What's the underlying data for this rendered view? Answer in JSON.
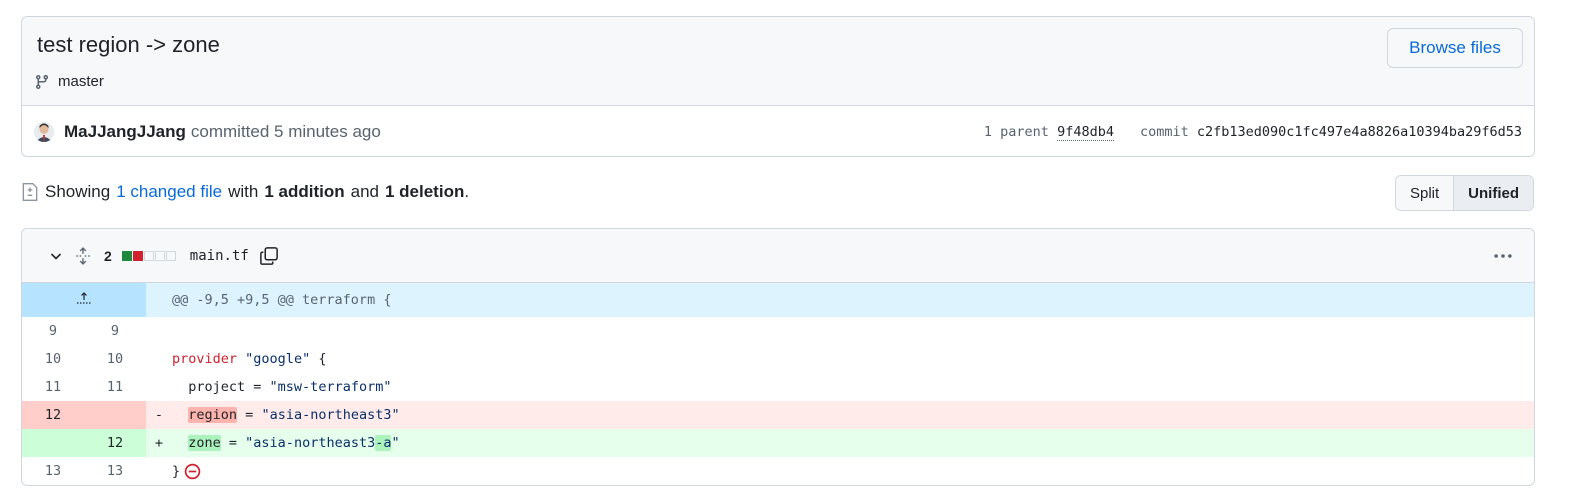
{
  "commit": {
    "title": "test region -> zone",
    "branch": "master",
    "browse_label": "Browse files",
    "author": "MaJJangJJang",
    "committed_text": "committed 5 minutes ago",
    "parent_label": "1 parent",
    "parent_sha": "9f48db4",
    "commit_label": "commit",
    "commit_sha": "c2fb13ed090c1fc497e4a8826a10394ba29f6d53"
  },
  "summary": {
    "showing": "Showing",
    "changed_link": "1 changed file",
    "with": "with",
    "additions": "1 addition",
    "and": "and",
    "deletions": "1 deletion",
    "period": "."
  },
  "view_toggle": {
    "split": "Split",
    "unified": "Unified"
  },
  "file": {
    "change_count": "2",
    "name": "main.tf",
    "hunk_header": "@@ -9,5 +9,5 @@ terraform {",
    "lines": [
      {
        "old": "9",
        "new": "9",
        "sign": "",
        "text": ""
      },
      {
        "old": "10",
        "new": "10",
        "sign": "",
        "kw": "provider",
        "rest": " ",
        "str": "\"google\"",
        "tail": " {"
      },
      {
        "old": "11",
        "new": "11",
        "sign": "",
        "pre": "  project = ",
        "str": "\"msw-terraform\""
      },
      {
        "old": "12",
        "new": "",
        "sign": "-",
        "pre": "  ",
        "hl": "region",
        "mid": " = ",
        "str": "\"asia-northeast3\""
      },
      {
        "old": "",
        "new": "12",
        "sign": "+",
        "pre": "  ",
        "hl": "zone",
        "mid": " = ",
        "str_a": "\"asia-northeast3",
        "str_hl": "-a",
        "str_b": "\""
      },
      {
        "old": "13",
        "new": "13",
        "sign": "",
        "text": "}"
      }
    ]
  },
  "colors": {
    "link": "#0969da",
    "add": "#1f883d",
    "del": "#cf222e",
    "hunk_bg": "#ddf4ff"
  }
}
